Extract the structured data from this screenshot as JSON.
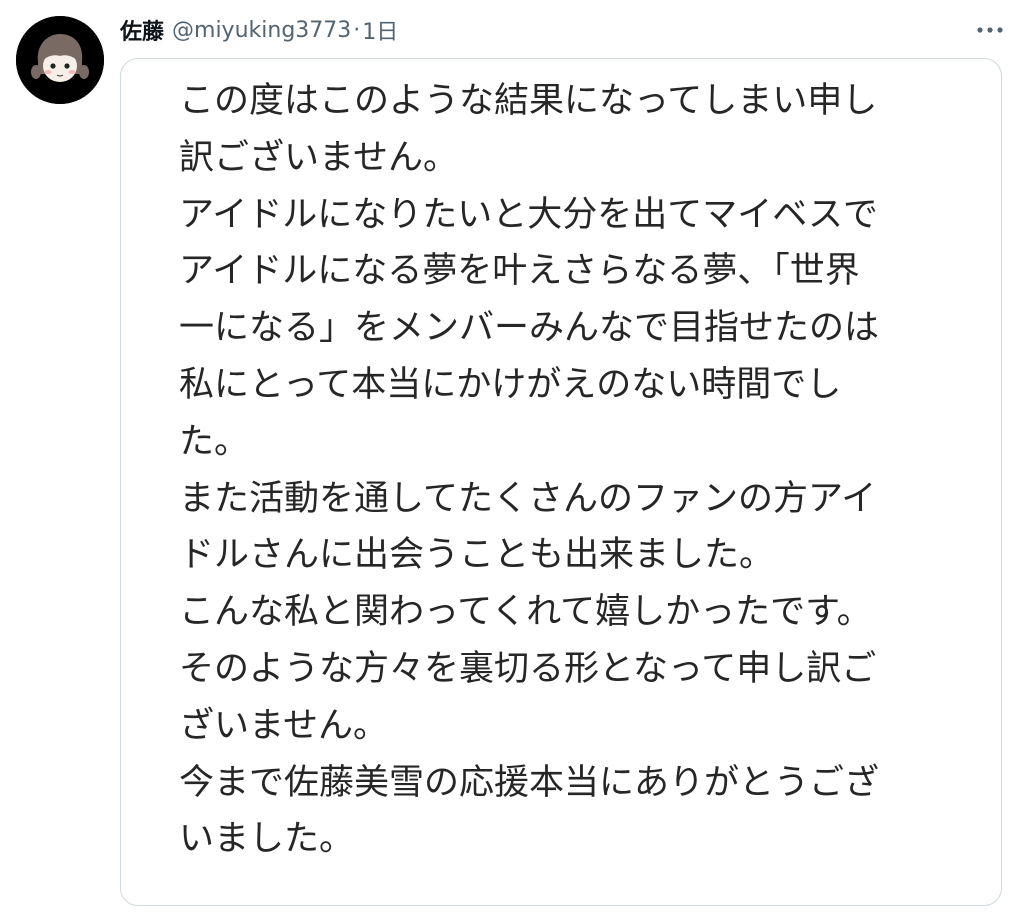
{
  "user": {
    "display_name": "佐藤",
    "handle": "@miyuking3773",
    "separator": "·",
    "timestamp": "1日",
    "avatar_icon": "avatar-illustration"
  },
  "actions": {
    "more_icon": "more-options-icon"
  },
  "colors": {
    "avatar_bg": "#000000",
    "secondary_text": "#536471",
    "card_border": "#cfd9de",
    "body_text": "#262626"
  },
  "note": {
    "lines": [
      "この度はこのような結果になってしまい申し",
      "訳ございません。",
      "アイドルになりたいと大分を出てマイベスで",
      "アイドルになる夢を叶えさらなる夢、「世界",
      "一になる」をメンバーみんなで目指せたのは",
      "私にとって本当にかけがえのない時間でし",
      "た。",
      "また活動を通してたくさんのファンの方アイ",
      "ドルさんに出会うことも出来ました。",
      "こんな私と関わってくれて嬉しかったです。",
      "そのような方々を裏切る形となって申し訳ご",
      "ざいません。",
      "今まで佐藤美雪の応援本当にありがとうござ",
      "いました。"
    ]
  }
}
